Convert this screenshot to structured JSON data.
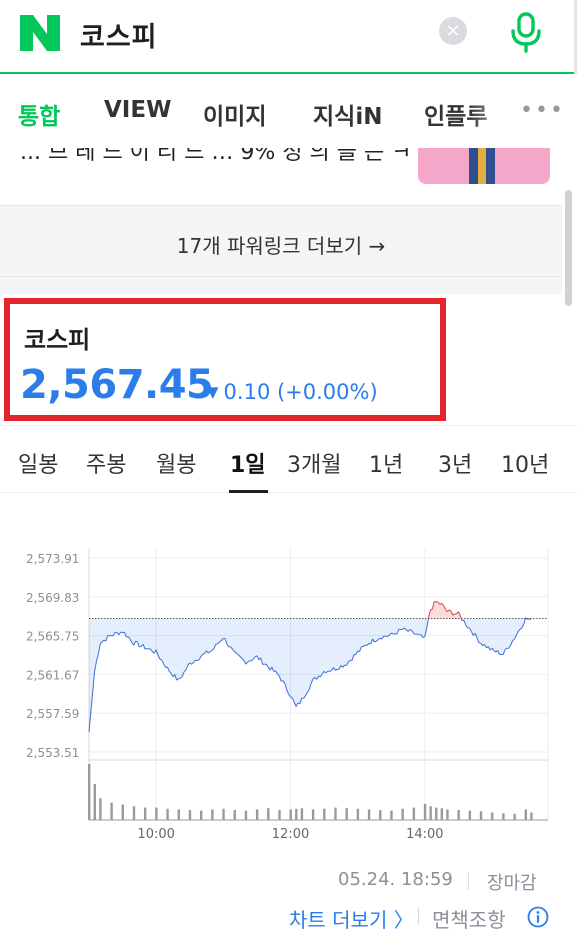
{
  "search": {
    "query": "코스피",
    "clear_icon": "close-circle-icon",
    "mic_icon": "microphone-icon",
    "logo": "N"
  },
  "tabs": [
    "통합",
    "VIEW",
    "이미지",
    "지식iN",
    "인플루"
  ],
  "tabs_more_icon": "more-dots-icon",
  "ad": {
    "truncated_text": "... 브 레 드 이 리 드 … 9% 정 의 을 는 ㅋ ...",
    "powerlink_label": "17개 파워링크 더보기 →"
  },
  "stock": {
    "name": "코스피",
    "price": "2,567.45",
    "direction": "down",
    "change": "0.10 (+0.00%)",
    "color": "#2b7de9"
  },
  "period_tabs": [
    "일봉",
    "주봉",
    "월봉",
    "1일",
    "3개월",
    "1년",
    "3년",
    "10년"
  ],
  "period_active": "1일",
  "chart_data": {
    "type": "line",
    "y_ticks": [
      "2,573.91",
      "2,569.83",
      "2,565.75",
      "2,561.67",
      "2,557.59",
      "2,553.51"
    ],
    "x_ticks": [
      "10:00",
      "12:00",
      "14:00"
    ],
    "ylim": [
      2553.51,
      2573.91
    ],
    "previous_close": 2567.55,
    "x": [
      "09:00",
      "09:05",
      "09:10",
      "09:20",
      "09:30",
      "09:40",
      "09:50",
      "10:00",
      "10:10",
      "10:20",
      "10:30",
      "10:40",
      "10:50",
      "11:00",
      "11:10",
      "11:20",
      "11:30",
      "11:40",
      "11:50",
      "12:00",
      "12:05",
      "12:10",
      "12:20",
      "12:30",
      "12:40",
      "12:50",
      "13:00",
      "13:10",
      "13:20",
      "13:30",
      "13:40",
      "13:50",
      "14:00",
      "14:05",
      "14:10",
      "14:15",
      "14:20",
      "14:30",
      "14:40",
      "14:50",
      "15:00",
      "15:10",
      "15:20",
      "15:30",
      "15:35"
    ],
    "y": [
      2555.6,
      2562.0,
      2565.0,
      2565.8,
      2566.2,
      2565.0,
      2564.5,
      2564.0,
      2562.3,
      2561.0,
      2562.8,
      2563.6,
      2564.2,
      2565.6,
      2563.8,
      2563.0,
      2563.5,
      2562.5,
      2561.5,
      2559.5,
      2558.2,
      2559.0,
      2561.0,
      2562.0,
      2562.3,
      2562.8,
      2564.0,
      2565.0,
      2565.6,
      2565.8,
      2566.4,
      2566.0,
      2565.4,
      2568.5,
      2569.3,
      2569.0,
      2568.3,
      2568.0,
      2566.5,
      2565.0,
      2564.2,
      2563.8,
      2565.5,
      2567.5,
      2567.45
    ],
    "volume": [
      90,
      58,
      35,
      28,
      25,
      22,
      20,
      20,
      18,
      17,
      16,
      15,
      17,
      18,
      16,
      15,
      17,
      19,
      16,
      17,
      18,
      19,
      17,
      18,
      20,
      19,
      18,
      17,
      16,
      15,
      18,
      20,
      26,
      22,
      20,
      19,
      17,
      16,
      15,
      14,
      12,
      11,
      10,
      17,
      12
    ]
  },
  "footer": {
    "timestamp": "05.24. 18:59",
    "status": "장마감",
    "more_chart": "차트 더보기 〉",
    "disclaimer": "면책조항"
  },
  "colors": {
    "accent_green": "#03c75a",
    "down_blue": "#2b7de9",
    "up_red": "#e5242b"
  }
}
